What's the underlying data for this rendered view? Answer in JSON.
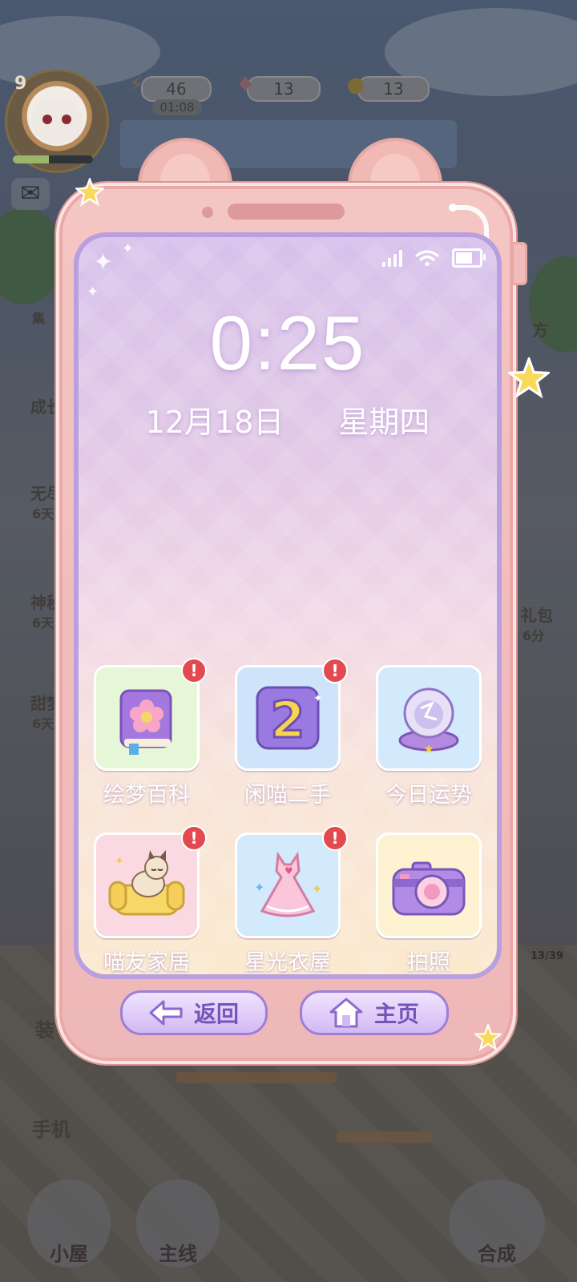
{
  "hud": {
    "level": "9",
    "energy": "46",
    "energy_timer": "01:08",
    "gems": "13",
    "coins": "13",
    "xp_fraction": 0.45
  },
  "background": {
    "side_labels": [
      "集",
      "成长",
      "无尽",
      "6天",
      "神秘",
      "6天",
      "甜梦",
      "6天",
      "方",
      "礼包",
      "6分"
    ],
    "left_buttons": {
      "decor": "装",
      "phone": "手机"
    },
    "counter": "13/39",
    "bottom_nav": [
      {
        "label": "小屋"
      },
      {
        "label": "主线"
      },
      {
        "label": "合成"
      }
    ]
  },
  "phone": {
    "clock": "0:25",
    "date": "12月18日",
    "weekday": "星期四",
    "status": {
      "signal_bars": 4,
      "battery_level": 0.85
    },
    "apps": [
      {
        "label": "绘梦百科",
        "icon": "book-flower-icon",
        "badge": "!",
        "bg": "#e6f7d8"
      },
      {
        "label": "闲喵二手",
        "icon": "number-2-icon",
        "badge": "!",
        "bg": "#cfe4fb"
      },
      {
        "label": "今日运势",
        "icon": "crystal-ball-icon",
        "badge": "",
        "bg": "#d3eafc"
      },
      {
        "label": "喵友家居",
        "icon": "cat-sofa-icon",
        "badge": "!",
        "bg": "#fbd9e2"
      },
      {
        "label": "星光衣屋",
        "icon": "dress-icon",
        "badge": "!",
        "bg": "#d2eafb"
      },
      {
        "label": "拍照",
        "icon": "camera-icon",
        "badge": "",
        "bg": "#fdf3d3"
      }
    ],
    "back_label": "返回",
    "home_label": "主页"
  },
  "colors": {
    "phone_body": "#f1bcbb",
    "screen_border": "#b79fe0",
    "nav_text": "#7654b8",
    "badge": "#e24a4f"
  }
}
